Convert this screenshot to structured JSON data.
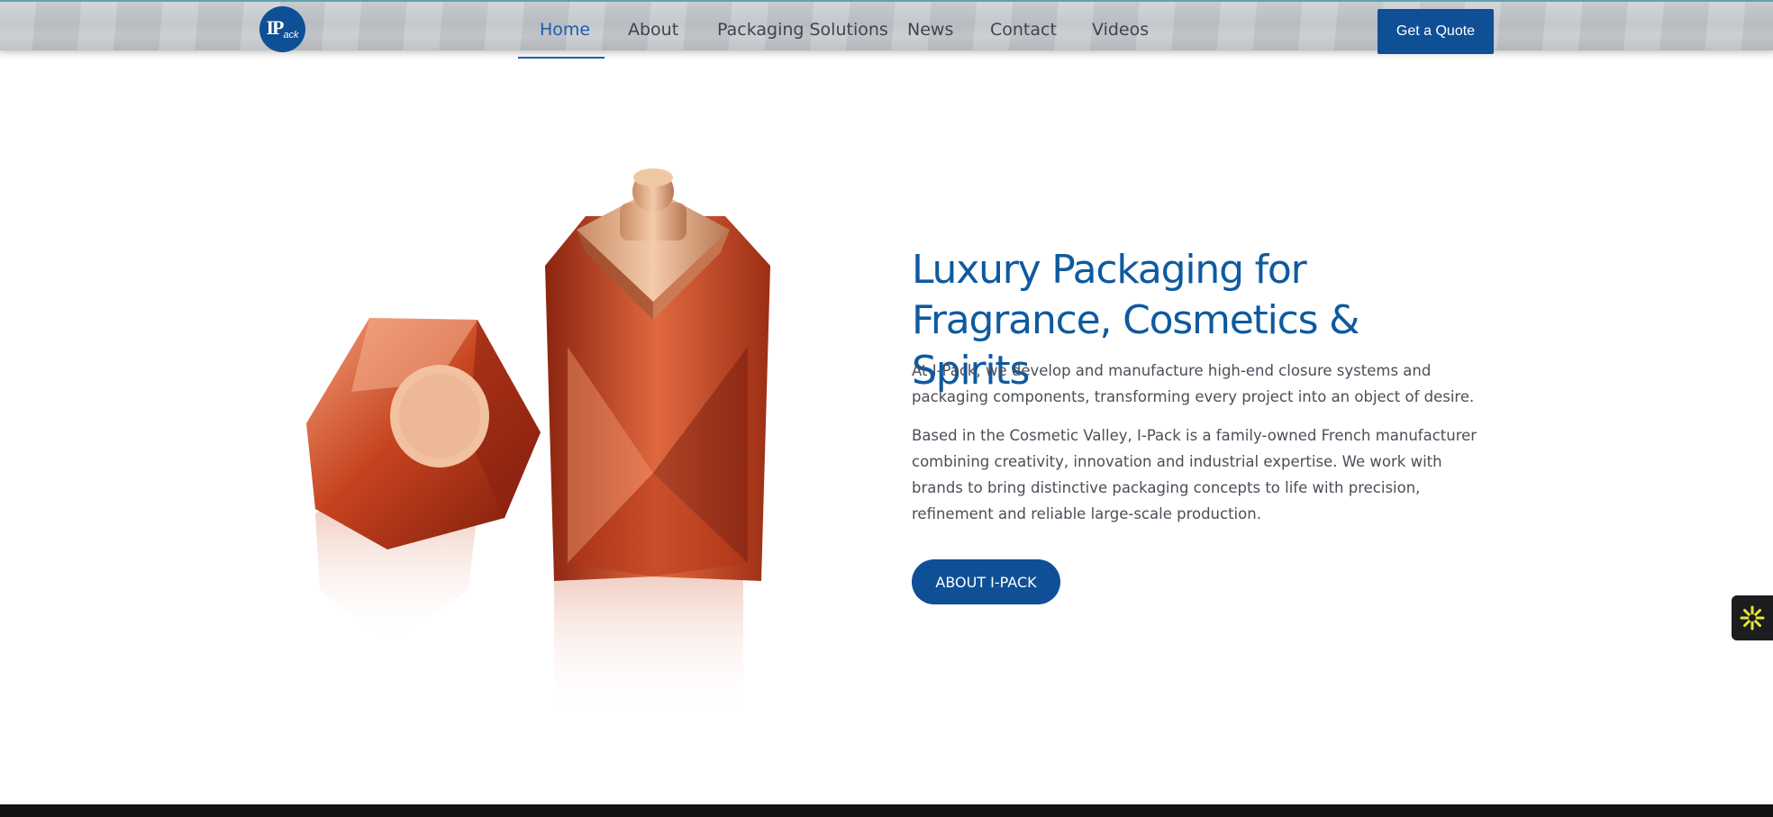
{
  "header": {
    "logo_text": "IPack",
    "nav": [
      {
        "label": "Home",
        "active": true
      },
      {
        "label": "About"
      },
      {
        "label": "Packaging Solutions"
      },
      {
        "label": "News"
      },
      {
        "label": "Contact"
      },
      {
        "label": "Videos"
      }
    ],
    "cta_label": "Get a Quote"
  },
  "hero": {
    "title": "Luxury Packaging for Fragrance, Cosmetics & Spirits",
    "paragraph_1": "At I-Pack, we develop and manufacture high-end closure systems and packaging components, transforming every project into an object of desire.",
    "paragraph_2": "Based in the Cosmetic Valley, I-Pack is a family-owned French manufacturer combining creativity, innovation and industrial expertise. We work with brands to bring distinctive packaging concepts to life with precision, refinement and reliable large-scale production.",
    "button_label": "ABOUT I-PACK",
    "image_alt": "perfume-bottles-image"
  },
  "widget": {
    "icon": "accessibility-icon"
  },
  "colors": {
    "brand_blue": "#0e4f96",
    "title_blue": "#0e5aa0",
    "active_nav": "#1f5ea8",
    "body_text": "#4a4f58",
    "footer": "#121212"
  }
}
